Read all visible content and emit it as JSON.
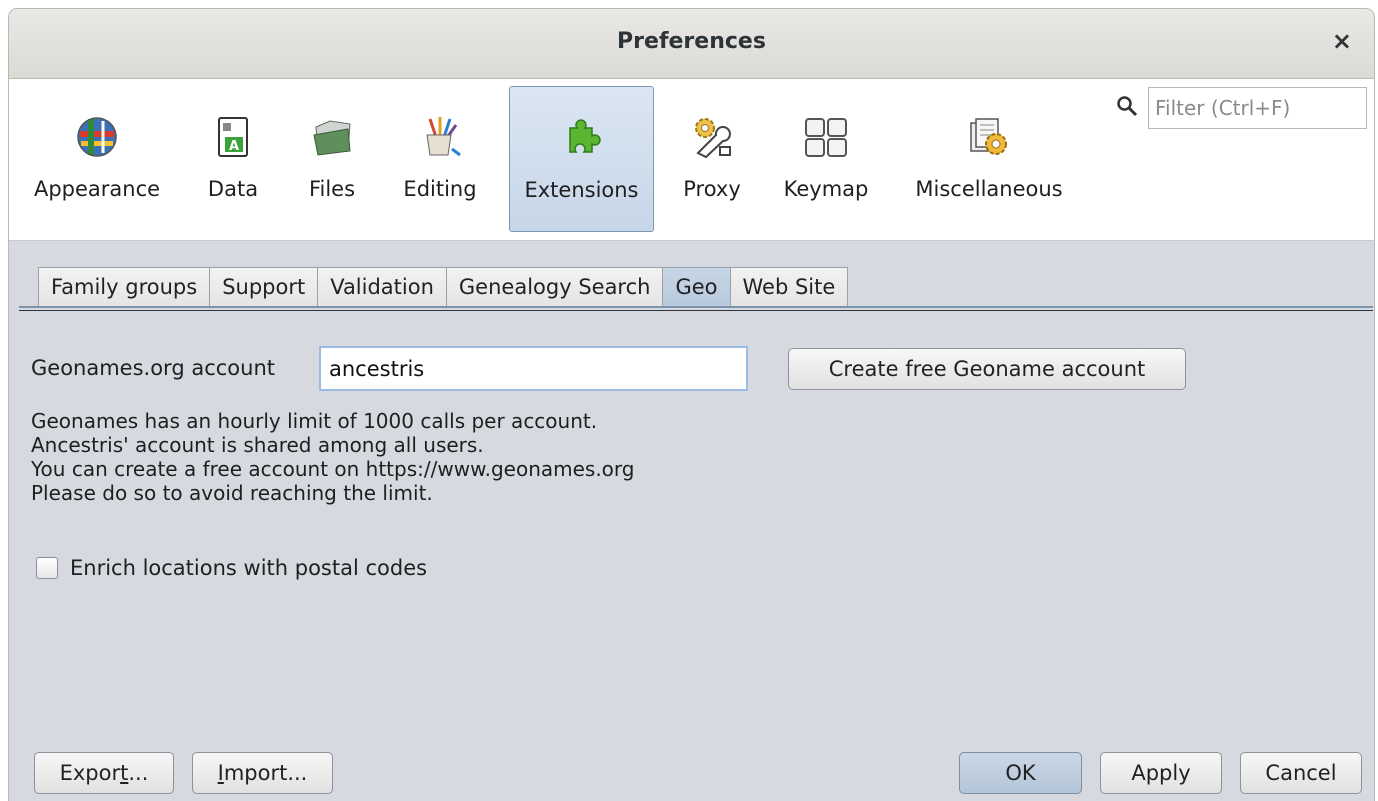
{
  "window": {
    "title": "Preferences",
    "close_glyph": "×"
  },
  "categories": [
    {
      "label": "Appearance",
      "icon": "globe-flags-icon"
    },
    {
      "label": "Data",
      "icon": "data-document-icon"
    },
    {
      "label": "Files",
      "icon": "folder-icon"
    },
    {
      "label": "Editing",
      "icon": "brushes-cup-icon"
    },
    {
      "label": "Extensions",
      "icon": "puzzle-piece-icon",
      "selected": true
    },
    {
      "label": "Proxy",
      "icon": "gear-wrench-icon"
    },
    {
      "label": "Keymap",
      "icon": "keyboard-keys-icon"
    },
    {
      "label": "Miscellaneous",
      "icon": "documents-gear-icon"
    }
  ],
  "filter": {
    "placeholder": "Filter (Ctrl+F)"
  },
  "tabs": [
    {
      "label": "Family groups"
    },
    {
      "label": "Support"
    },
    {
      "label": "Validation"
    },
    {
      "label": "Genealogy Search"
    },
    {
      "label": "Geo",
      "active": true
    },
    {
      "label": "Web Site"
    }
  ],
  "geo": {
    "account_label": "Geonames.org account",
    "account_value": "ancestris",
    "create_button": "Create free Geoname account",
    "info_lines": [
      "Geonames has an hourly limit of 1000 calls per account.",
      "Ancestris' account is shared among all users.",
      "You can create a free account on https://www.geonames.org",
      "Please do so to avoid reaching the limit."
    ],
    "postal_checkbox_label": "Enrich locations with postal codes",
    "postal_checked": false
  },
  "buttons": {
    "export_pre": "Expor",
    "export_mnemonic": "t",
    "export_post": "...",
    "import_mnemonic": "I",
    "import_post": "mport...",
    "ok": "OK",
    "apply": "Apply",
    "cancel": "Cancel"
  },
  "colors": {
    "accent": "#b8c9dc",
    "window_bg": "#d6d9df",
    "selected_border": "#7c98b8"
  }
}
